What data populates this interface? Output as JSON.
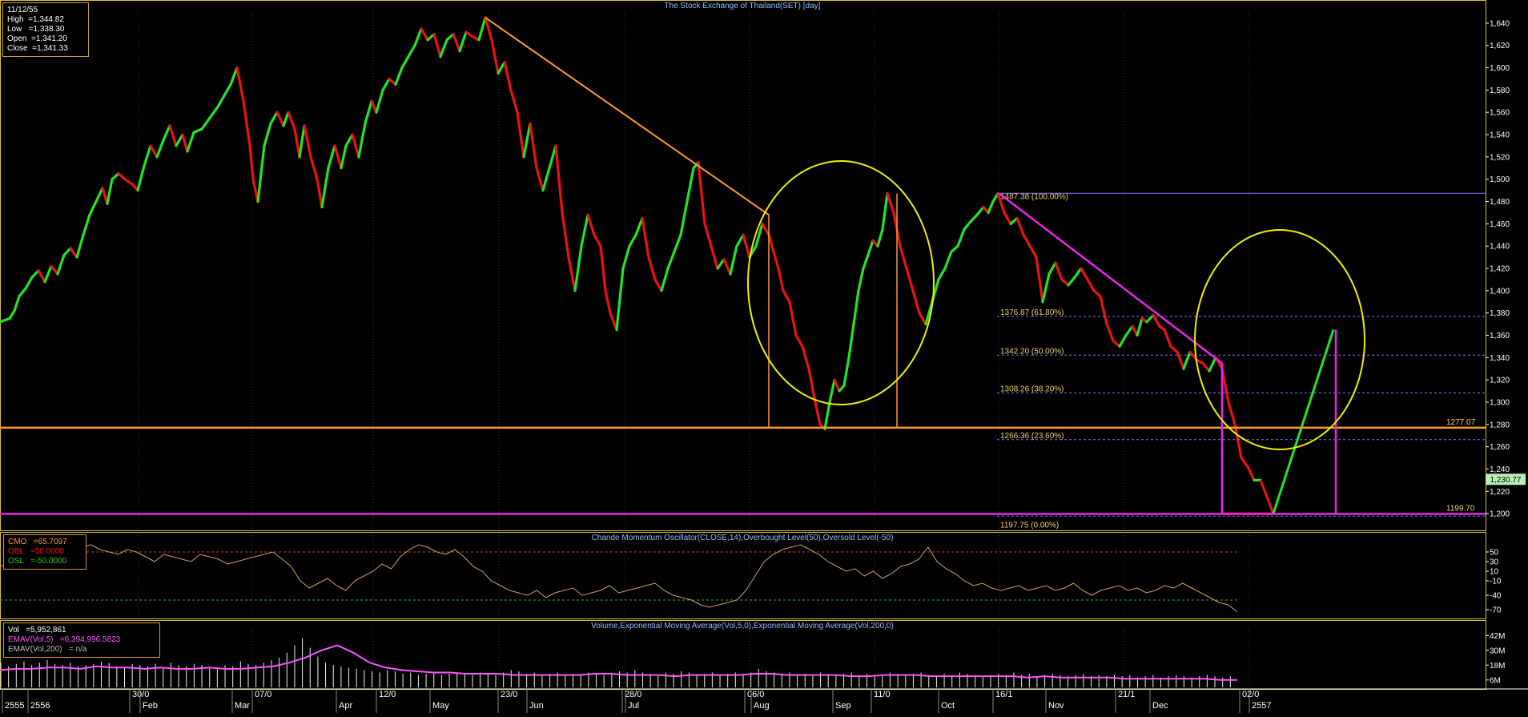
{
  "colors": {
    "background": "#000000",
    "up": "#22e622",
    "down": "#ee1111",
    "orange": "#ff9933",
    "magenta": "#ee22ee",
    "yellow": "#f0f000",
    "panel_border": "#d8c040",
    "fib": "#f0d060",
    "cmo": "#d0a060",
    "volume": "#f0f0f0",
    "ema": "#ff55ff"
  },
  "main_title": "The Stock Exchange of Thailand(SET) [day]",
  "info": {
    "date": "11/12/55",
    "high": "High  =1,344.82",
    "low": "Low   =1,338.30",
    "open": "Open  =1,341.20",
    "close": "Close  =1,341.33"
  },
  "cmo_title": "Chande Momentum Oscillator(CLOSE,14),Overbought Level(50),Oversold Level(-50)",
  "cmo_info": {
    "cmo": "CMO   =65.7097",
    "obl": "OBL   =50.0000",
    "osl": "OSL   =-50.0000"
  },
  "vol_title": "Volume,Exponential Moving Average(Vol,5,0),Exponential Moving Average(Vol,200,0)",
  "vol_info": {
    "vol": "Vol   =5,952,861",
    "ema5": "EMAV(Vol,5)   =6,394,996.5823",
    "ema200": "EMAV(Vol,200)   = n/a"
  },
  "current_price_label": "1,230.77",
  "support_labels": [
    "1277.07",
    "1199.70"
  ],
  "fib_labels": [
    "1487.38 (100.00%)",
    "1376.87 (61.80%)",
    "1342.20 (50.00%)",
    "1308.26 (38.20%)",
    "1266.36 (23.60%)",
    "1197.75 (0.00%)"
  ],
  "x_axis_labels": [
    "2555",
    "2556",
    "30/0",
    "Feb",
    "07/0",
    "Mar",
    "Apr",
    "12/0",
    "May",
    "23/0",
    "Jun",
    "28/0",
    "Jul",
    "06/0",
    "Aug",
    "Sep",
    "11/0",
    "Oct",
    "16/1",
    "Nov",
    "21/1",
    "Dec",
    "02/0",
    "2557"
  ],
  "chart_data": [
    {
      "type": "line",
      "title": "The Stock Exchange of Thailand(SET) [day]",
      "ylim": [
        1185,
        1650
      ],
      "y_ticks": [
        "1,200",
        "1,220",
        "1,240",
        "1,260",
        "1,280",
        "1,300",
        "1,320",
        "1,340",
        "1,360",
        "1,380",
        "1,400",
        "1,420",
        "1,440",
        "1,460",
        "1,480",
        "1,500",
        "1,520",
        "1,540",
        "1,560",
        "1,580",
        "1,600",
        "1,620",
        "1,640"
      ],
      "close_keypoints": [
        [
          0,
          1372
        ],
        [
          12,
          1375
        ],
        [
          18,
          1382
        ],
        [
          24,
          1395
        ],
        [
          32,
          1402
        ],
        [
          40,
          1412
        ],
        [
          48,
          1418
        ],
        [
          56,
          1408
        ],
        [
          64,
          1422
        ],
        [
          72,
          1415
        ],
        [
          80,
          1432
        ],
        [
          88,
          1438
        ],
        [
          96,
          1430
        ],
        [
          104,
          1450
        ],
        [
          112,
          1468
        ],
        [
          120,
          1480
        ],
        [
          128,
          1492
        ],
        [
          134,
          1478
        ],
        [
          140,
          1500
        ],
        [
          148,
          1505
        ],
        [
          156,
          1500
        ],
        [
          166,
          1495
        ],
        [
          172,
          1490
        ],
        [
          180,
          1512
        ],
        [
          188,
          1530
        ],
        [
          196,
          1520
        ],
        [
          204,
          1535
        ],
        [
          212,
          1548
        ],
        [
          220,
          1530
        ],
        [
          228,
          1540
        ],
        [
          234,
          1525
        ],
        [
          242,
          1542
        ],
        [
          252,
          1545
        ],
        [
          262,
          1555
        ],
        [
          272,
          1565
        ],
        [
          280,
          1575
        ],
        [
          288,
          1585
        ],
        [
          296,
          1600
        ],
        [
          304,
          1570
        ],
        [
          312,
          1530
        ],
        [
          316,
          1500
        ],
        [
          322,
          1480
        ],
        [
          330,
          1530
        ],
        [
          338,
          1550
        ],
        [
          346,
          1560
        ],
        [
          354,
          1548
        ],
        [
          360,
          1560
        ],
        [
          368,
          1545
        ],
        [
          374,
          1520
        ],
        [
          380,
          1548
        ],
        [
          388,
          1520
        ],
        [
          396,
          1500
        ],
        [
          402,
          1475
        ],
        [
          410,
          1510
        ],
        [
          418,
          1530
        ],
        [
          426,
          1510
        ],
        [
          432,
          1530
        ],
        [
          440,
          1540
        ],
        [
          448,
          1520
        ],
        [
          456,
          1550
        ],
        [
          464,
          1570
        ],
        [
          470,
          1560
        ],
        [
          478,
          1580
        ],
        [
          486,
          1590
        ],
        [
          494,
          1585
        ],
        [
          502,
          1600
        ],
        [
          510,
          1610
        ],
        [
          518,
          1620
        ],
        [
          526,
          1635
        ],
        [
          534,
          1625
        ],
        [
          542,
          1630
        ],
        [
          550,
          1610
        ],
        [
          558,
          1625
        ],
        [
          566,
          1630
        ],
        [
          574,
          1615
        ],
        [
          582,
          1632
        ],
        [
          590,
          1628
        ],
        [
          598,
          1625
        ],
        [
          606,
          1645
        ],
        [
          614,
          1625
        ],
        [
          622,
          1595
        ],
        [
          630,
          1605
        ],
        [
          638,
          1580
        ],
        [
          646,
          1560
        ],
        [
          654,
          1520
        ],
        [
          662,
          1550
        ],
        [
          670,
          1510
        ],
        [
          678,
          1490
        ],
        [
          686,
          1510
        ],
        [
          694,
          1530
        ],
        [
          702,
          1470
        ],
        [
          710,
          1430
        ],
        [
          718,
          1400
        ],
        [
          726,
          1440
        ],
        [
          734,
          1468
        ],
        [
          742,
          1450
        ],
        [
          750,
          1440
        ],
        [
          756,
          1400
        ],
        [
          762,
          1380
        ],
        [
          770,
          1365
        ],
        [
          778,
          1420
        ],
        [
          786,
          1440
        ],
        [
          794,
          1450
        ],
        [
          802,
          1465
        ],
        [
          810,
          1430
        ],
        [
          818,
          1410
        ],
        [
          826,
          1400
        ],
        [
          834,
          1420
        ],
        [
          842,
          1435
        ],
        [
          850,
          1450
        ],
        [
          858,
          1480
        ],
        [
          866,
          1510
        ],
        [
          872,
          1515
        ],
        [
          880,
          1460
        ],
        [
          888,
          1440
        ],
        [
          896,
          1420
        ],
        [
          904,
          1428
        ],
        [
          912,
          1415
        ],
        [
          920,
          1440
        ],
        [
          928,
          1450
        ],
        [
          936,
          1430
        ],
        [
          944,
          1440
        ],
        [
          952,
          1460
        ],
        [
          960,
          1450
        ],
        [
          966,
          1435
        ],
        [
          972,
          1420
        ],
        [
          978,
          1400
        ],
        [
          986,
          1390
        ],
        [
          994,
          1360
        ],
        [
          1002,
          1350
        ],
        [
          1010,
          1330
        ],
        [
          1018,
          1300
        ],
        [
          1024,
          1280
        ],
        [
          1030,
          1276
        ],
        [
          1036,
          1300
        ],
        [
          1042,
          1320
        ],
        [
          1048,
          1310
        ],
        [
          1054,
          1315
        ],
        [
          1060,
          1340
        ],
        [
          1066,
          1370
        ],
        [
          1072,
          1400
        ],
        [
          1078,
          1420
        ],
        [
          1084,
          1432
        ],
        [
          1090,
          1445
        ],
        [
          1096,
          1440
        ],
        [
          1102,
          1455
        ],
        [
          1108,
          1487
        ],
        [
          1116,
          1470
        ],
        [
          1124,
          1440
        ],
        [
          1132,
          1420
        ],
        [
          1140,
          1400
        ],
        [
          1148,
          1380
        ],
        [
          1156,
          1370
        ],
        [
          1164,
          1390
        ],
        [
          1172,
          1410
        ],
        [
          1180,
          1420
        ],
        [
          1188,
          1435
        ],
        [
          1196,
          1440
        ],
        [
          1204,
          1455
        ],
        [
          1212,
          1462
        ],
        [
          1220,
          1468
        ],
        [
          1228,
          1475
        ],
        [
          1234,
          1470
        ],
        [
          1240,
          1480
        ],
        [
          1246,
          1487
        ],
        [
          1254,
          1470
        ],
        [
          1262,
          1460
        ],
        [
          1270,
          1465
        ],
        [
          1278,
          1450
        ],
        [
          1286,
          1440
        ],
        [
          1294,
          1430
        ],
        [
          1302,
          1390
        ],
        [
          1310,
          1415
        ],
        [
          1318,
          1425
        ],
        [
          1326,
          1410
        ],
        [
          1334,
          1405
        ],
        [
          1342,
          1412
        ],
        [
          1350,
          1420
        ],
        [
          1358,
          1410
        ],
        [
          1366,
          1400
        ],
        [
          1374,
          1395
        ],
        [
          1382,
          1370
        ],
        [
          1390,
          1355
        ],
        [
          1398,
          1350
        ],
        [
          1406,
          1360
        ],
        [
          1414,
          1368
        ],
        [
          1420,
          1360
        ],
        [
          1426,
          1375
        ],
        [
          1432,
          1372
        ],
        [
          1440,
          1378
        ],
        [
          1448,
          1368
        ],
        [
          1454,
          1365
        ],
        [
          1462,
          1350
        ],
        [
          1470,
          1345
        ],
        [
          1478,
          1330
        ],
        [
          1486,
          1345
        ],
        [
          1494,
          1338
        ],
        [
          1502,
          1335
        ],
        [
          1510,
          1328
        ],
        [
          1518,
          1340
        ],
        [
          1526,
          1330
        ],
        [
          1534,
          1300
        ],
        [
          1542,
          1280
        ],
        [
          1550,
          1250
        ],
        [
          1558,
          1242
        ],
        [
          1566,
          1230
        ],
        [
          1574,
          1230
        ]
      ],
      "projection": [
        [
          1527,
          1200
        ],
        [
          1590,
          1200
        ],
        [
          1665,
          1365
        ]
      ],
      "resistance_line": [
        [
          606,
          1645
        ],
        [
          960,
          1468
        ]
      ],
      "downtrend_line": [
        [
          1248,
          1487
        ],
        [
          1526,
          1335
        ]
      ],
      "support_levels": [
        1277.07,
        1199.7
      ],
      "current_price": 1230.77,
      "vertical_markers": [
        [
          960,
          1277,
          1468
        ],
        [
          1120,
          1277,
          1487
        ],
        [
          1526,
          1200,
          1335
        ],
        [
          1668,
          1200,
          1365
        ]
      ],
      "ellipses": [
        [
          1050,
          353,
          116,
          152
        ],
        [
          1598,
          424,
          106,
          137
        ]
      ],
      "fib_levels": [
        1487.38,
        1376.87,
        1342.2,
        1308.26,
        1266.36,
        1197.75
      ]
    },
    {
      "type": "line",
      "title": "Chande Momentum Oscillator(CLOSE,14),Overbought Level(50),Oversold Level(-50)",
      "ylim": [
        -85,
        85
      ],
      "y_ticks": [
        "50",
        "30",
        "10",
        "-10",
        "-40",
        "-70"
      ],
      "overbought": 50,
      "oversold": -50,
      "values": [
        20,
        25,
        15,
        35,
        30,
        45,
        40,
        55,
        50,
        60,
        65,
        55,
        50,
        45,
        55,
        50,
        40,
        30,
        45,
        40,
        35,
        30,
        45,
        40,
        35,
        25,
        30,
        35,
        40,
        45,
        50,
        35,
        20,
        -10,
        -25,
        -15,
        -5,
        -20,
        -30,
        -10,
        0,
        10,
        25,
        15,
        40,
        55,
        65,
        60,
        50,
        45,
        55,
        40,
        20,
        10,
        -10,
        -20,
        -30,
        -35,
        -40,
        -30,
        -45,
        -35,
        -30,
        -25,
        -40,
        -35,
        -30,
        -20,
        -35,
        -30,
        -25,
        -20,
        -15,
        -30,
        -40,
        -45,
        -50,
        -60,
        -65,
        -60,
        -55,
        -50,
        -30,
        0,
        30,
        45,
        55,
        60,
        65,
        55,
        45,
        30,
        20,
        10,
        15,
        0,
        10,
        -5,
        5,
        20,
        25,
        35,
        60,
        30,
        15,
        5,
        -10,
        -20,
        -15,
        -25,
        -30,
        -25,
        -20,
        -30,
        -25,
        -20,
        -30,
        -25,
        -15,
        -30,
        -40,
        -30,
        -25,
        -20,
        -30,
        -25,
        -35,
        -30,
        -20,
        -25,
        -15,
        -25,
        -35,
        -45,
        -55,
        -60,
        -75
      ]
    },
    {
      "type": "bar",
      "title": "Volume,Exponential Moving Average(Vol,5,0),Exponential Moving Average(Vol,200,0)",
      "ylim": [
        0,
        48
      ],
      "y_ticks": [
        "6M",
        "18M",
        "30M",
        "42M"
      ],
      "volume_values": [
        20,
        17,
        19,
        21,
        18,
        20,
        22,
        19,
        18,
        20,
        17,
        18,
        19,
        21,
        20,
        17,
        16,
        19,
        18,
        17,
        19,
        16,
        20,
        18,
        17,
        19,
        18,
        16,
        15,
        18,
        17,
        21,
        19,
        18,
        20,
        22,
        24,
        28,
        34,
        40,
        32,
        25,
        20,
        18,
        17,
        16,
        15,
        14,
        13,
        12,
        14,
        13,
        11,
        12,
        10,
        11,
        12,
        10,
        11,
        12,
        11,
        10,
        12,
        11,
        10,
        12,
        14,
        13,
        11,
        12,
        10,
        11,
        12,
        10,
        11,
        10,
        12,
        11,
        10,
        12,
        13,
        12,
        14,
        12,
        11,
        10,
        12,
        11,
        13,
        12,
        10,
        11,
        12,
        10,
        11,
        12,
        10,
        12,
        15,
        13,
        12,
        11,
        12,
        10,
        11,
        10,
        12,
        11,
        10,
        11,
        12,
        10,
        11,
        10,
        9,
        12,
        11,
        10,
        11,
        12,
        10,
        9,
        11,
        10,
        12,
        11,
        10,
        9,
        10,
        11,
        10,
        12,
        10,
        11,
        9,
        10,
        11,
        10,
        9,
        10,
        11,
        9,
        10,
        9,
        10,
        9,
        10,
        8,
        9,
        10,
        8,
        9,
        10,
        9,
        8,
        9,
        10,
        9,
        8,
        9
      ],
      "ema_values": [
        14,
        15,
        15,
        16,
        16,
        15,
        17,
        16,
        16,
        15,
        16,
        15,
        15,
        16,
        15,
        15,
        16,
        17,
        20,
        24,
        30,
        34,
        28,
        20,
        16,
        14,
        13,
        12,
        12,
        11,
        11,
        11,
        10,
        10,
        10,
        10,
        10,
        11,
        11,
        10,
        10,
        10,
        9,
        10,
        10,
        10,
        10,
        11,
        11,
        10,
        10,
        10,
        10,
        9,
        9,
        10,
        10,
        10,
        9,
        9,
        9,
        9,
        9,
        9,
        8,
        9,
        8,
        8,
        8,
        8,
        7,
        7,
        7,
        7,
        7,
        7,
        6,
        6
      ]
    }
  ]
}
